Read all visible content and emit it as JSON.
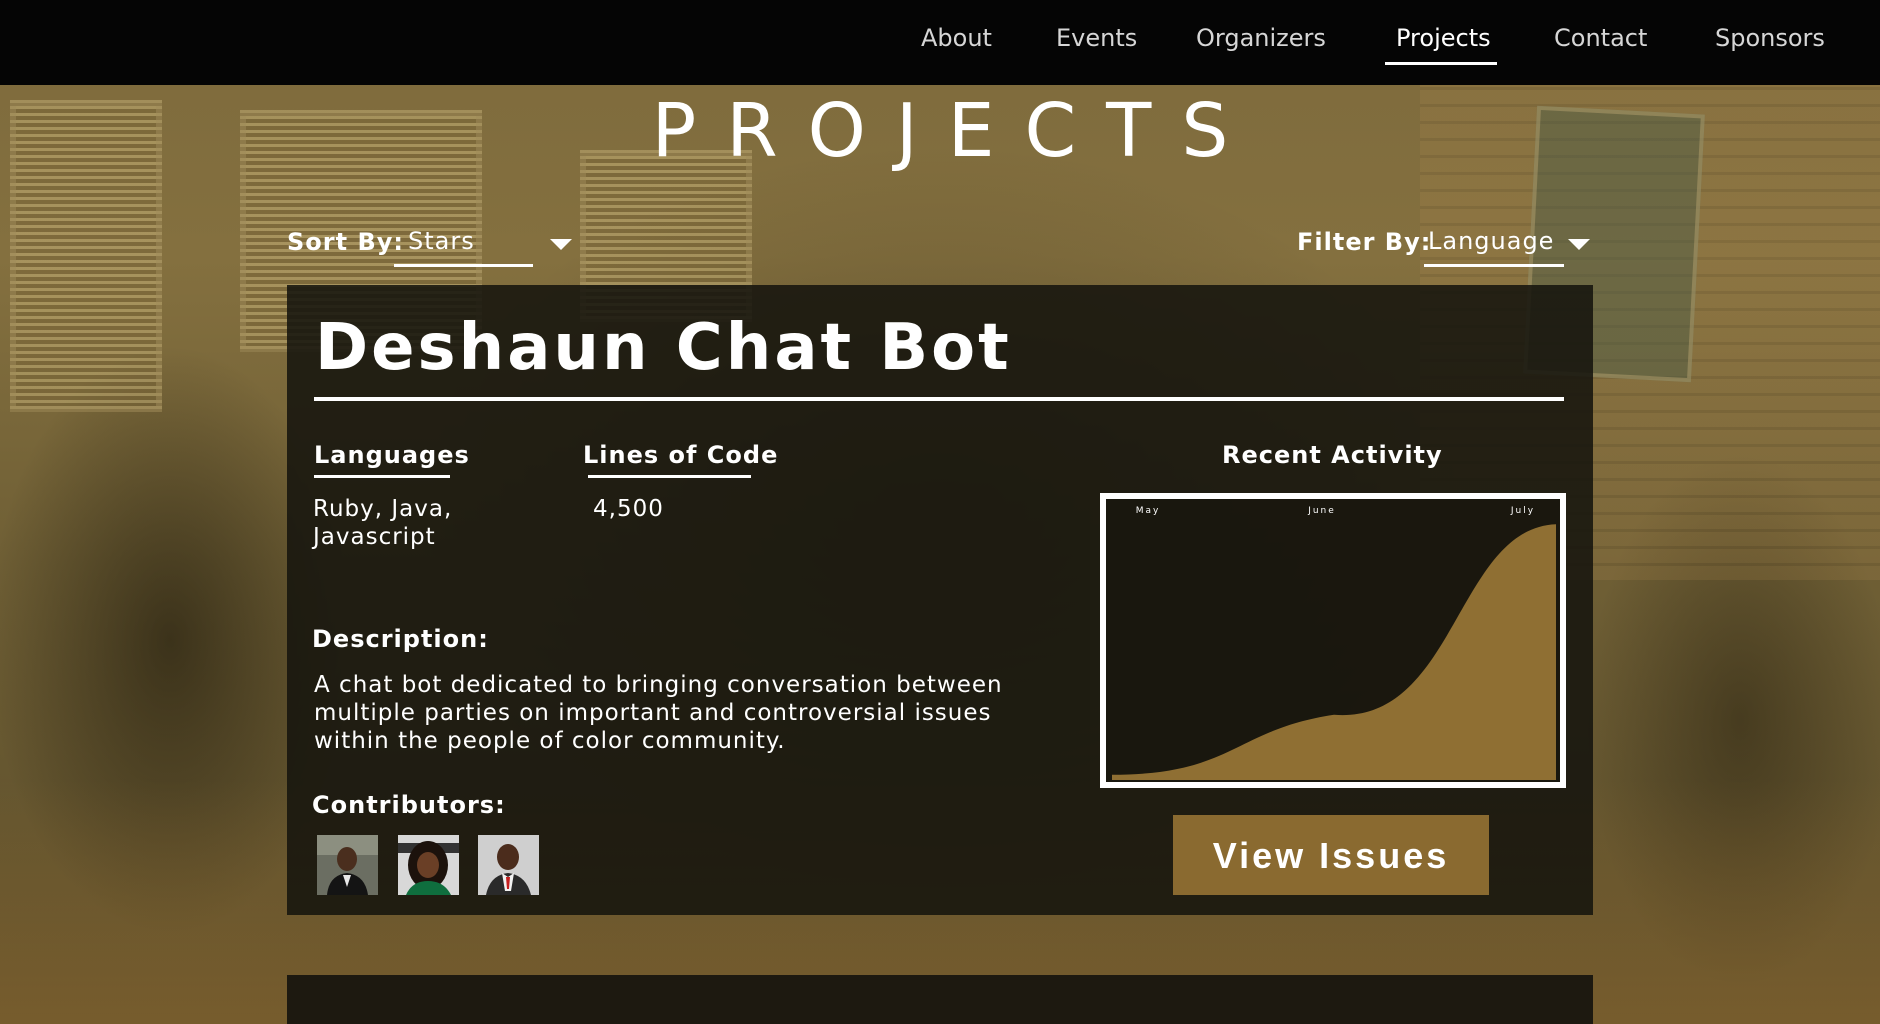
{
  "nav": {
    "items": [
      {
        "label": "About"
      },
      {
        "label": "Events"
      },
      {
        "label": "Organizers"
      },
      {
        "label": "Projects",
        "active": true
      },
      {
        "label": "Contact"
      },
      {
        "label": "Sponsors"
      }
    ]
  },
  "page": {
    "title": "PROJECTS"
  },
  "controls": {
    "sort_label": "Sort By:",
    "sort_value": "Stars",
    "filter_label": "Filter By:",
    "filter_value": "Language"
  },
  "project": {
    "name": "Deshaun Chat Bot",
    "languages_label": "Languages",
    "languages_value_line1": "Ruby, Java,",
    "languages_value_line2": "Javascript",
    "loc_label": "Lines of Code",
    "loc_value": "4,500",
    "description_label": "Description:",
    "description_lines": [
      "A chat bot dedicated to bringing conversation between",
      "multiple parties on important and controversial issues",
      "within the people of color community."
    ],
    "contributors_label": "Contributors:",
    "contributors": [
      {
        "icon": "avatar-photo-1"
      },
      {
        "icon": "avatar-photo-2"
      },
      {
        "icon": "avatar-photo-3"
      }
    ],
    "activity_label": "Recent Activity",
    "view_issues_label": "View Issues"
  },
  "chart_data": {
    "type": "area",
    "x": [
      "May",
      "June",
      "July"
    ],
    "series": [
      {
        "values": [
          0.02,
          0.25,
          0.98
        ]
      }
    ],
    "ylim": [
      0,
      1
    ],
    "grid": false
  },
  "colors": {
    "accent": "#8a6a30",
    "nav_bg": "#050505",
    "card_bg": "#16140e",
    "chart_fill": "#8f6f33"
  }
}
